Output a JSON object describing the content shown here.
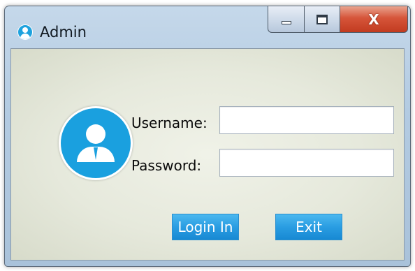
{
  "window": {
    "title": "Admin",
    "minimize_icon": "minimize-icon",
    "maximize_icon": "maximize-icon",
    "close_label": "X"
  },
  "form": {
    "username_label": "Username:",
    "username_value": "",
    "password_label": "Password:",
    "password_value": "",
    "login_label": "Login In",
    "exit_label": "Exit"
  },
  "colors": {
    "accent": "#1aa0df",
    "button": "#2a9de2",
    "close": "#c8452a",
    "background": "#e6e9dc"
  }
}
